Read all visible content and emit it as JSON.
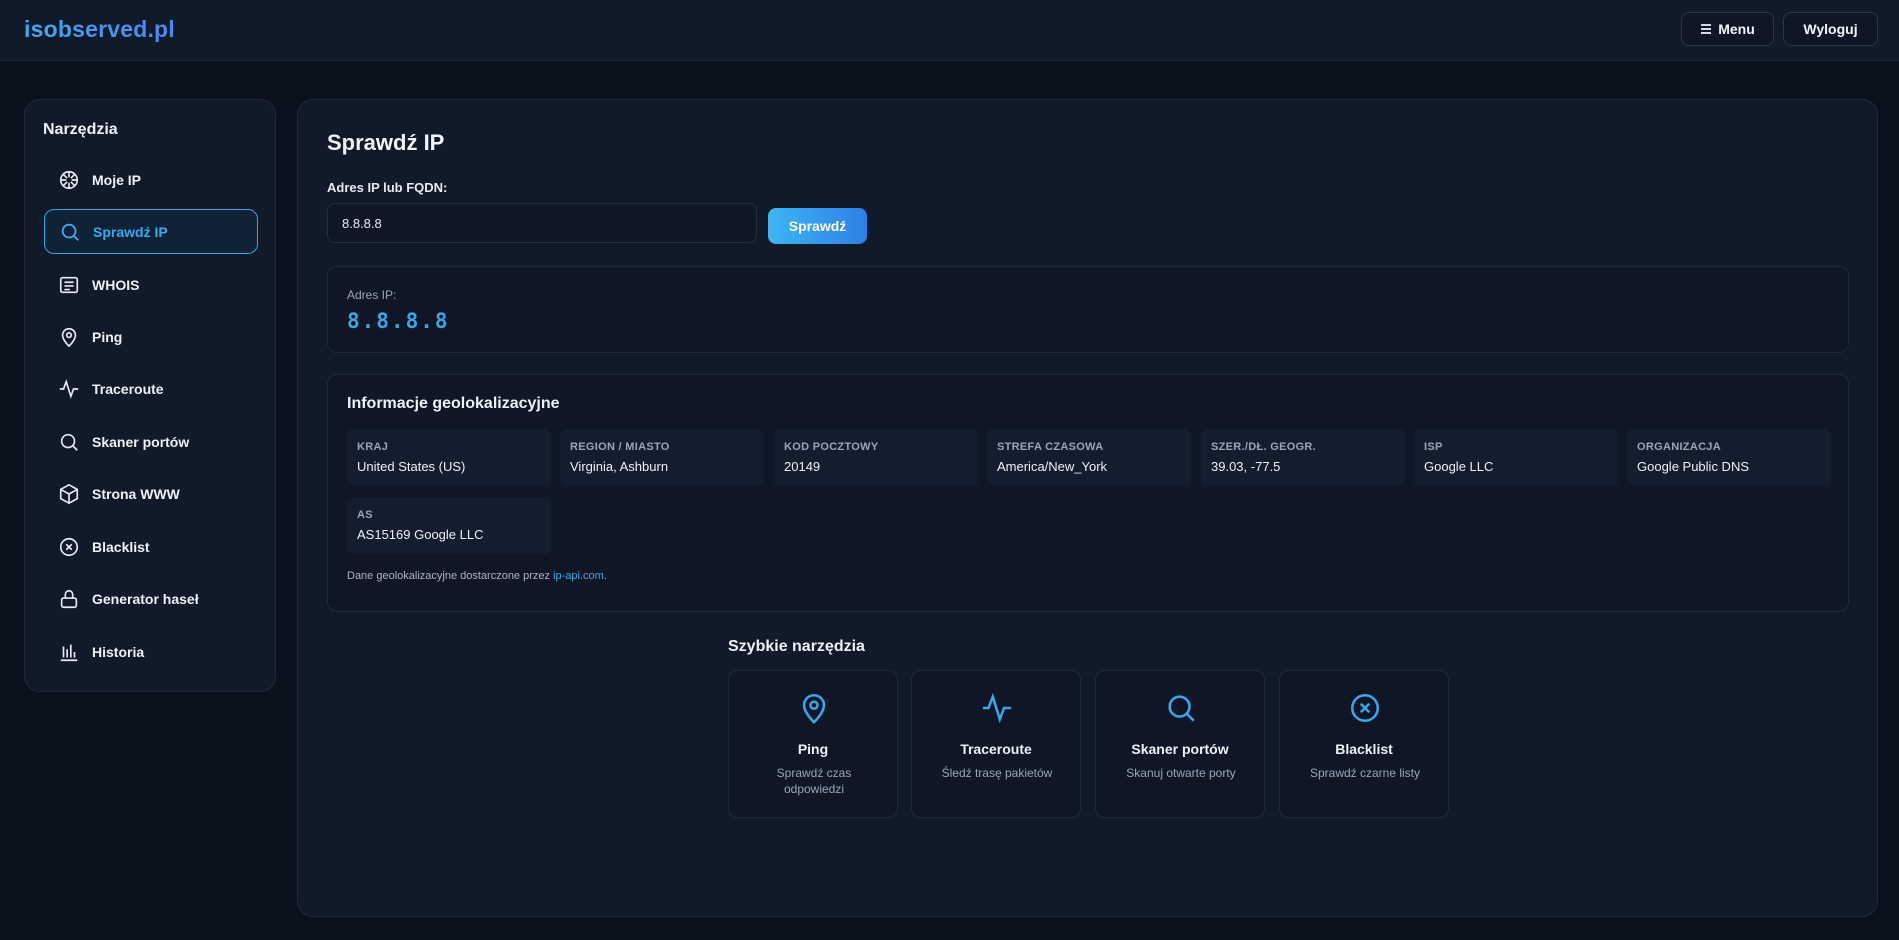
{
  "header": {
    "logo": "isobserved.pl",
    "menu_label": "Menu",
    "logout_label": "Wyloguj"
  },
  "sidebar": {
    "title": "Narzędzia",
    "items": [
      {
        "label": "Moje IP",
        "icon": "aperture-icon"
      },
      {
        "label": "Sprawdź IP",
        "icon": "search-icon",
        "active": true
      },
      {
        "label": "WHOIS",
        "icon": "document-icon"
      },
      {
        "label": "Ping",
        "icon": "map-pin-icon"
      },
      {
        "label": "Traceroute",
        "icon": "activity-icon"
      },
      {
        "label": "Skaner portów",
        "icon": "search-icon"
      },
      {
        "label": "Strona WWW",
        "icon": "cube-icon"
      },
      {
        "label": "Blacklist",
        "icon": "x-circle-icon"
      },
      {
        "label": "Generator haseł",
        "icon": "lock-icon"
      },
      {
        "label": "Historia",
        "icon": "bar-chart-icon"
      }
    ]
  },
  "main": {
    "title": "Sprawdź IP",
    "input_label": "Adres IP lub FQDN:",
    "input_value": "8.8.8.8",
    "check_button": "Sprawdź",
    "result_label": "Adres IP:",
    "result_value": "8.8.8.8",
    "geo": {
      "title": "Informacje geolokalizacyjne",
      "fields": [
        {
          "key": "KRAJ",
          "value": "United States (US)"
        },
        {
          "key": "REGION / MIASTO",
          "value": "Virginia, Ashburn"
        },
        {
          "key": "KOD POCZTOWY",
          "value": "20149"
        },
        {
          "key": "STREFA CZASOWA",
          "value": "America/New_York"
        },
        {
          "key": "SZER./DŁ. GEOGR.",
          "value": "39.03, -77.5"
        },
        {
          "key": "ISP",
          "value": "Google LLC"
        },
        {
          "key": "ORGANIZACJA",
          "value": "Google Public DNS"
        },
        {
          "key": "AS",
          "value": "AS15169 Google LLC"
        }
      ],
      "credit_prefix": "Dane geolokalizacyjne dostarczone przez",
      "credit_link": "ip-api.com",
      "credit_suffix": "."
    },
    "quick": {
      "title": "Szybkie narzędzia",
      "cards": [
        {
          "name": "Ping",
          "desc": "Sprawdź czas odpowiedzi",
          "icon": "map-pin-icon"
        },
        {
          "name": "Traceroute",
          "desc": "Śledź trasę pakietów",
          "icon": "activity-icon"
        },
        {
          "name": "Skaner portów",
          "desc": "Skanuj otwarte porty",
          "icon": "search-icon"
        },
        {
          "name": "Blacklist",
          "desc": "Sprawdź czarne listy",
          "icon": "x-circle-icon"
        }
      ]
    }
  },
  "colors": {
    "accent": "#3aa6ea",
    "background": "#0b111c",
    "panel": "#111a29"
  }
}
